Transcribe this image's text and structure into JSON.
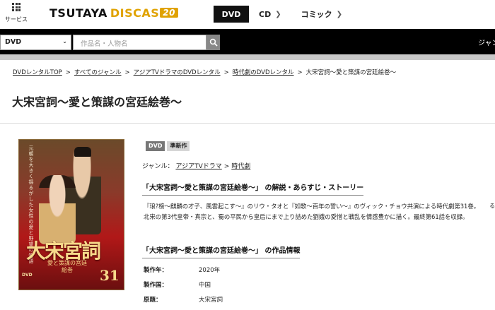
{
  "header": {
    "service_label": "サービス",
    "logo_main": "TSUTAYA",
    "logo_sub": "DISCAS",
    "logo_badge": "20",
    "nav": [
      {
        "label": "DVD"
      },
      {
        "label": "CD"
      },
      {
        "label": "コミック"
      }
    ]
  },
  "search": {
    "category": "DVD",
    "placeholder": "作品名・人物名",
    "right_cut_label": "ジャン"
  },
  "breadcrumb": [
    "DVDレンタルTOP",
    "すべてのジャンル",
    "アジアTVドラマのDVDレンタル",
    "時代劇のDVDレンタル",
    "大宋宮詞～愛と策謀の宮廷絵巻～"
  ],
  "page_title": "大宋宮詞～愛と策謀の宮廷絵巻～",
  "cover": {
    "title_text": "大宋宮詞",
    "subtitle_text": "愛と策謀の宮廷絵巻",
    "volume": "31",
    "format_mark": "DVD",
    "vertical_text": "元朝を大きく揺るがした女性の愛と野望の物語"
  },
  "badges": {
    "format": "DVD",
    "status": "準新作"
  },
  "genre": {
    "label": "ジャンル：",
    "items": [
      "アジアTVドラマ",
      "時代劇"
    ],
    "sep": ">"
  },
  "section_synopsis": {
    "heading": "「大宋宮詞～愛と策謀の宮廷絵巻～」 の解説・あらすじ・ストーリー",
    "text": "『琅?榜～麒麟の才子、風雲起こす～』のリウ・タオと『如歌～百年の誓い～』のヴィック・チョウ共演による時代劇第31巻。北宋の第3代皇帝・真宗と、蜀の平民から皇后にまで上り詰めた劉娥の愛憎と戦乱を情感豊かに描く。最終第61話を収録。",
    "more_cut": "る"
  },
  "section_info": {
    "heading": "「大宋宮詞～愛と策謀の宮廷絵巻～」 の作品情報",
    "rows": [
      {
        "key": "製作年：",
        "value": "2020年"
      },
      {
        "key": "製作国：",
        "value": "中国"
      },
      {
        "key": "原題：",
        "value": "大宋宮詞"
      }
    ]
  }
}
